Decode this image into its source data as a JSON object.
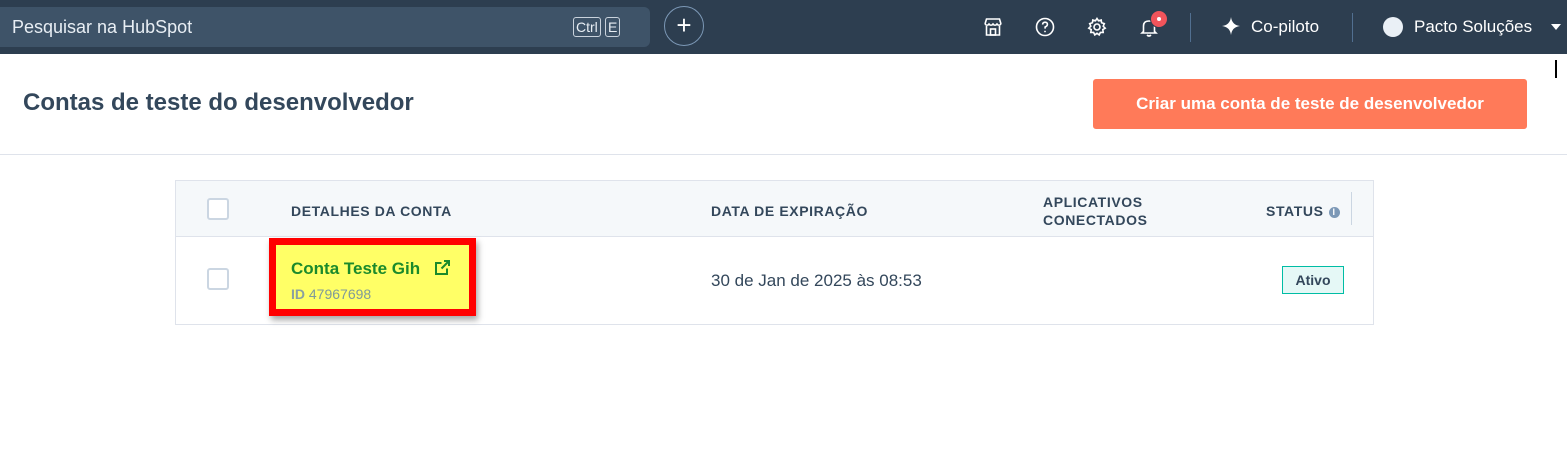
{
  "topbar": {
    "search_placeholder": "Pesquisar na HubSpot",
    "search_icon": "search-icon",
    "shortcut_ctrl": "Ctrl",
    "shortcut_key": "E",
    "icons": [
      "plus-icon",
      "marketplace-icon",
      "help-icon",
      "gear-icon",
      "bell-icon",
      "copilot-sparkle-icon",
      "avatar",
      "chevron-down-icon"
    ],
    "copilot_label": "Co-piloto",
    "account_name": "Pacto Soluções",
    "notification_badge_color": "#f2545b"
  },
  "page": {
    "title": "Contas de teste do desenvolvedor",
    "create_button_label": "Criar uma conta de teste de desenvolvedor",
    "accent_color": "#ff7a59"
  },
  "table": {
    "columns": {
      "details": "DETALHES DA CONTA",
      "expiry": "DATA DE EXPIRAÇÃO",
      "apps": "APLICATIVOS CONECTADOS",
      "status": "STATUS"
    },
    "rows": [
      {
        "name": "Conta Teste Gih",
        "id_label": "ID",
        "id_value": "47967698",
        "expiry": "30 de Jan de 2025 às 08:53",
        "apps": "",
        "status": "Ativo"
      }
    ]
  },
  "annotation": {
    "highlight_color": "#ffff66",
    "border_color": "#ff0000"
  }
}
